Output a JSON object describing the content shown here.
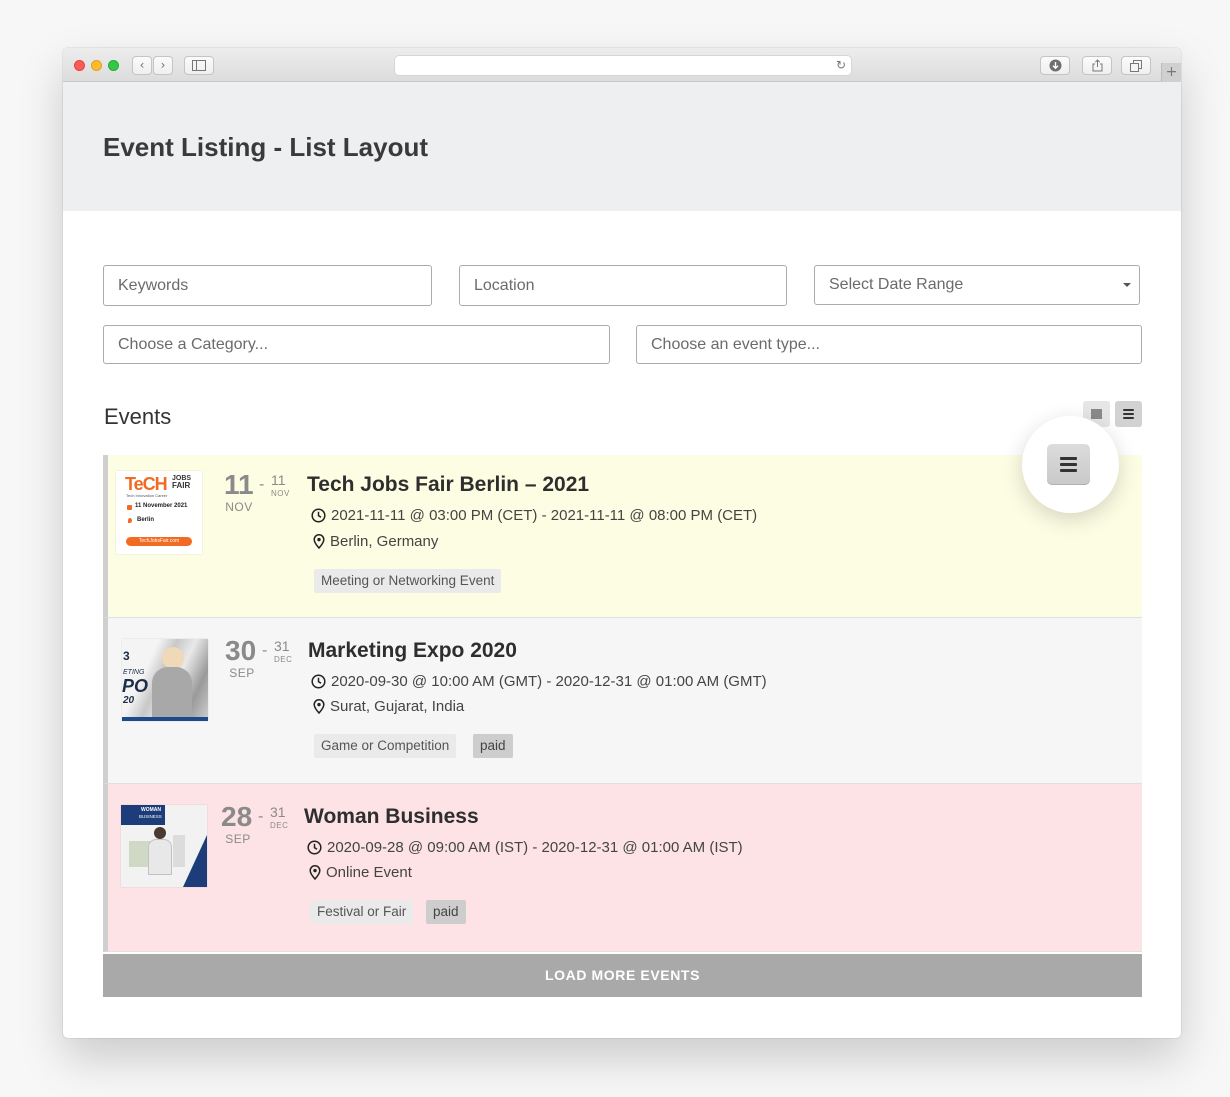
{
  "page": {
    "title": "Event Listing - List Layout"
  },
  "filters": {
    "keywords_placeholder": "Keywords",
    "location_placeholder": "Location",
    "date_range_label": "Select Date Range",
    "category_placeholder": "Choose a Category...",
    "event_type_placeholder": "Choose an event type..."
  },
  "events_section": {
    "heading": "Events",
    "view_mode": "list"
  },
  "events": [
    {
      "title": "Tech Jobs Fair Berlin – 2021",
      "start_day": "11",
      "start_month": "NOV",
      "end_day": "11",
      "end_month": "NOV",
      "datetime": "2021-11-11 @ 03:00 PM (CET) - 2021-11-11 @ 08:00 PM (CET)",
      "location": "Berlin, Germany",
      "tags": [
        "Meeting or Networking Event"
      ],
      "background": "#fdfde4",
      "thumb": {
        "brand_a": "TeCH",
        "brand_b": "JOBS",
        "brand_c": "FAIR",
        "sub": "Tech   Innovation   Career",
        "date": "11 November 2021",
        "city": "Berlin",
        "url": "TechJobsFair.com"
      }
    },
    {
      "title": "Marketing Expo 2020",
      "start_day": "30",
      "start_month": "SEP",
      "end_day": "31",
      "end_month": "DEC",
      "datetime": "2020-09-30 @ 10:00 AM (GMT) - 2020-12-31 @ 01:00 AM (GMT)",
      "location": "Surat, Gujarat, India",
      "tags": [
        "Game or Competition",
        "paid"
      ],
      "background": "#f6f6f6",
      "thumb": {
        "line1": "3",
        "line2": "ETING",
        "line3": "PO",
        "line4": "20"
      }
    },
    {
      "title": "Woman Business",
      "start_day": "28",
      "start_month": "SEP",
      "end_day": "31",
      "end_month": "DEC",
      "datetime": "2020-09-28 @ 09:00 AM (IST) - 2020-12-31 @ 01:00 AM (IST)",
      "location": "Online Event",
      "tags": [
        "Festival or Fair",
        "paid"
      ],
      "background": "#fde3e5",
      "thumb": {
        "line1": "WOMAN",
        "line2": "BUSINESS"
      }
    }
  ],
  "load_more_label": "LOAD MORE EVENTS",
  "colors": {
    "header_bg": "#eeeff1",
    "load_more_bg": "#a9a9a9",
    "tag_bg": "#eaeaea",
    "paid_tag_bg": "#cdcdcd"
  }
}
